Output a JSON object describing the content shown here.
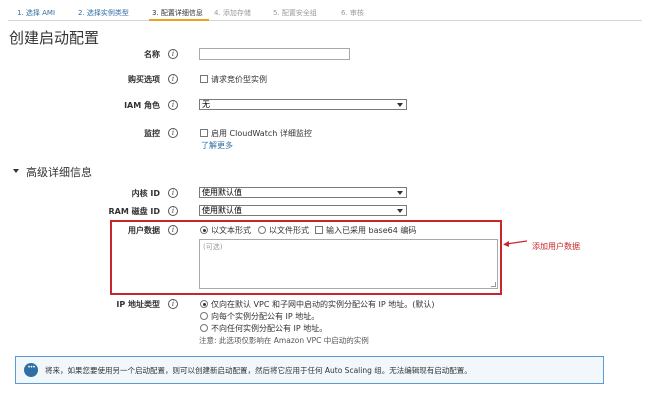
{
  "steps": [
    {
      "label": "1. 选择 AMI",
      "state": "done"
    },
    {
      "label": "2. 选择实例类型",
      "state": "done"
    },
    {
      "label": "3. 配置详细信息",
      "state": "active"
    },
    {
      "label": "4. 添加存储",
      "state": "todo"
    },
    {
      "label": "5. 配置安全组",
      "state": "todo"
    },
    {
      "label": "6. 审核",
      "state": "todo"
    }
  ],
  "page_title": "创建启动配置",
  "info_glyph": "i",
  "fields": {
    "name": {
      "label": "名称",
      "value": ""
    },
    "purchase": {
      "label": "购买选项",
      "option": "请求竞价型实例"
    },
    "iam": {
      "label": "IAM 角色",
      "value": "无"
    },
    "monitoring": {
      "label": "监控",
      "option": "启用 CloudWatch 详细监控",
      "link": "了解更多"
    }
  },
  "advanced": {
    "title": "高级详细信息",
    "kernel": {
      "label": "内核 ID",
      "value": "使用默认值"
    },
    "ramdisk": {
      "label": "RAM 磁盘 ID",
      "value": "使用默认值"
    },
    "userdata": {
      "label": "用户数据",
      "opt_text": "以文本形式",
      "opt_file": "以文件形式",
      "opt_base64": "输入已采用 base64 编码",
      "placeholder": "(可选)"
    },
    "ip": {
      "label": "IP 地址类型",
      "opt1": "仅向在默认 VPC 和子网中启动的实例分配公有 IP 地址。(默认)",
      "opt2": "向每个实例分配公有 IP 地址。",
      "opt3": "不向任何实例分配公有 IP 地址。",
      "note": "注意: 此选项仅影响在 Amazon VPC 中启动的实例"
    }
  },
  "annotation": "添加用户数据",
  "banner": "将来，如果您要使用另一个启动配置，则可以创建新启动配置，然后将它应用于任何 Auto Scaling 组。无法编辑现有启动配置。",
  "colors": {
    "accent": "#f0a020",
    "link": "#2f6fa5",
    "annotation": "#c8262c",
    "banner_border": "#5b9bd5"
  }
}
